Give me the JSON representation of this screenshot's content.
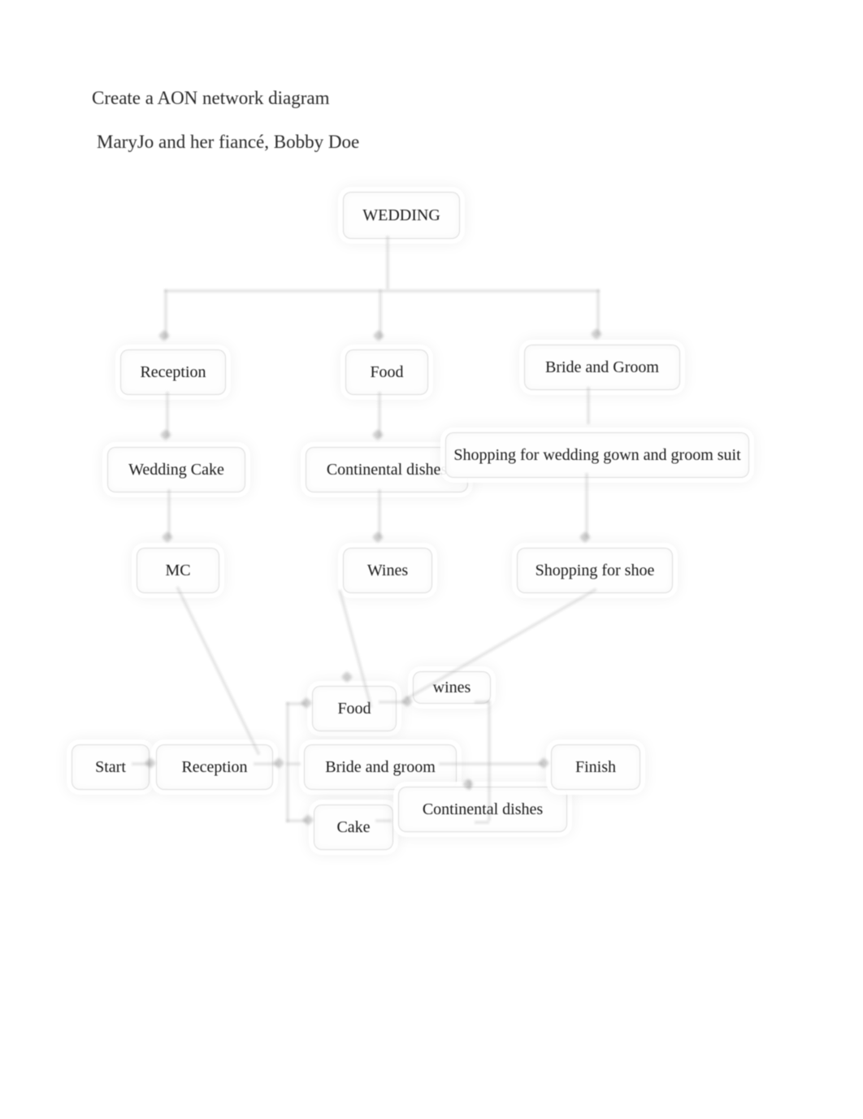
{
  "title": "Create a AON network diagram",
  "subtitle": "MaryJo and her fiancé, Bobby Doe",
  "nodes": {
    "wedding": "WEDDING",
    "reception": "Reception",
    "food": "Food",
    "bride_groom": "Bride and Groom",
    "wedding_cake": "Wedding Cake",
    "continental": "Continental dishes",
    "shopping_gown": "Shopping for wedding gown and groom suit",
    "mc": "MC",
    "wines": "Wines",
    "shopping_shoe": "Shopping for shoe",
    "start": "Start",
    "reception2": "Reception",
    "food2": "Food",
    "wines2": "wines",
    "bride_groom2": "Bride and groom",
    "cake2": "Cake",
    "continental2": "Continental dishes",
    "finish": "Finish"
  }
}
